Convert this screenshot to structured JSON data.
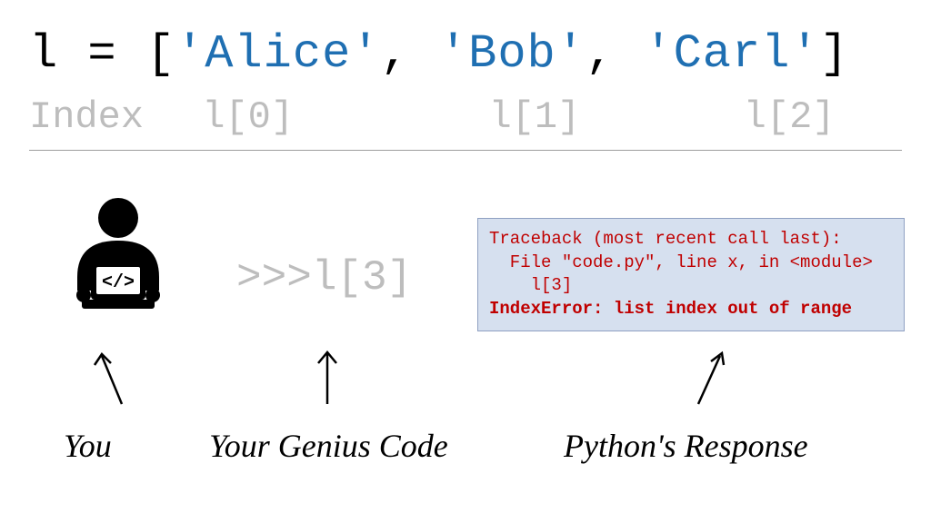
{
  "code": {
    "var": "l",
    "eq": " = ",
    "open": "[",
    "s1": "'Alice'",
    "c1": ", ",
    "s2": "'Bob'",
    "c2": ", ",
    "s3": "'Carl'",
    "close": "]"
  },
  "index": {
    "label": "Index",
    "i0": "l[0]",
    "i1": "l[1]",
    "i2": "l[2]"
  },
  "genius": ">>>l[3]",
  "traceback": {
    "l1": "Traceback (most recent call last):",
    "l2": "  File \"code.py\", line x, in <module>",
    "l3": "    l[3]",
    "l4": "IndexError: list index out of range"
  },
  "labels": {
    "you": "You",
    "genius": "Your Genius Code",
    "response": "Python's Response"
  }
}
